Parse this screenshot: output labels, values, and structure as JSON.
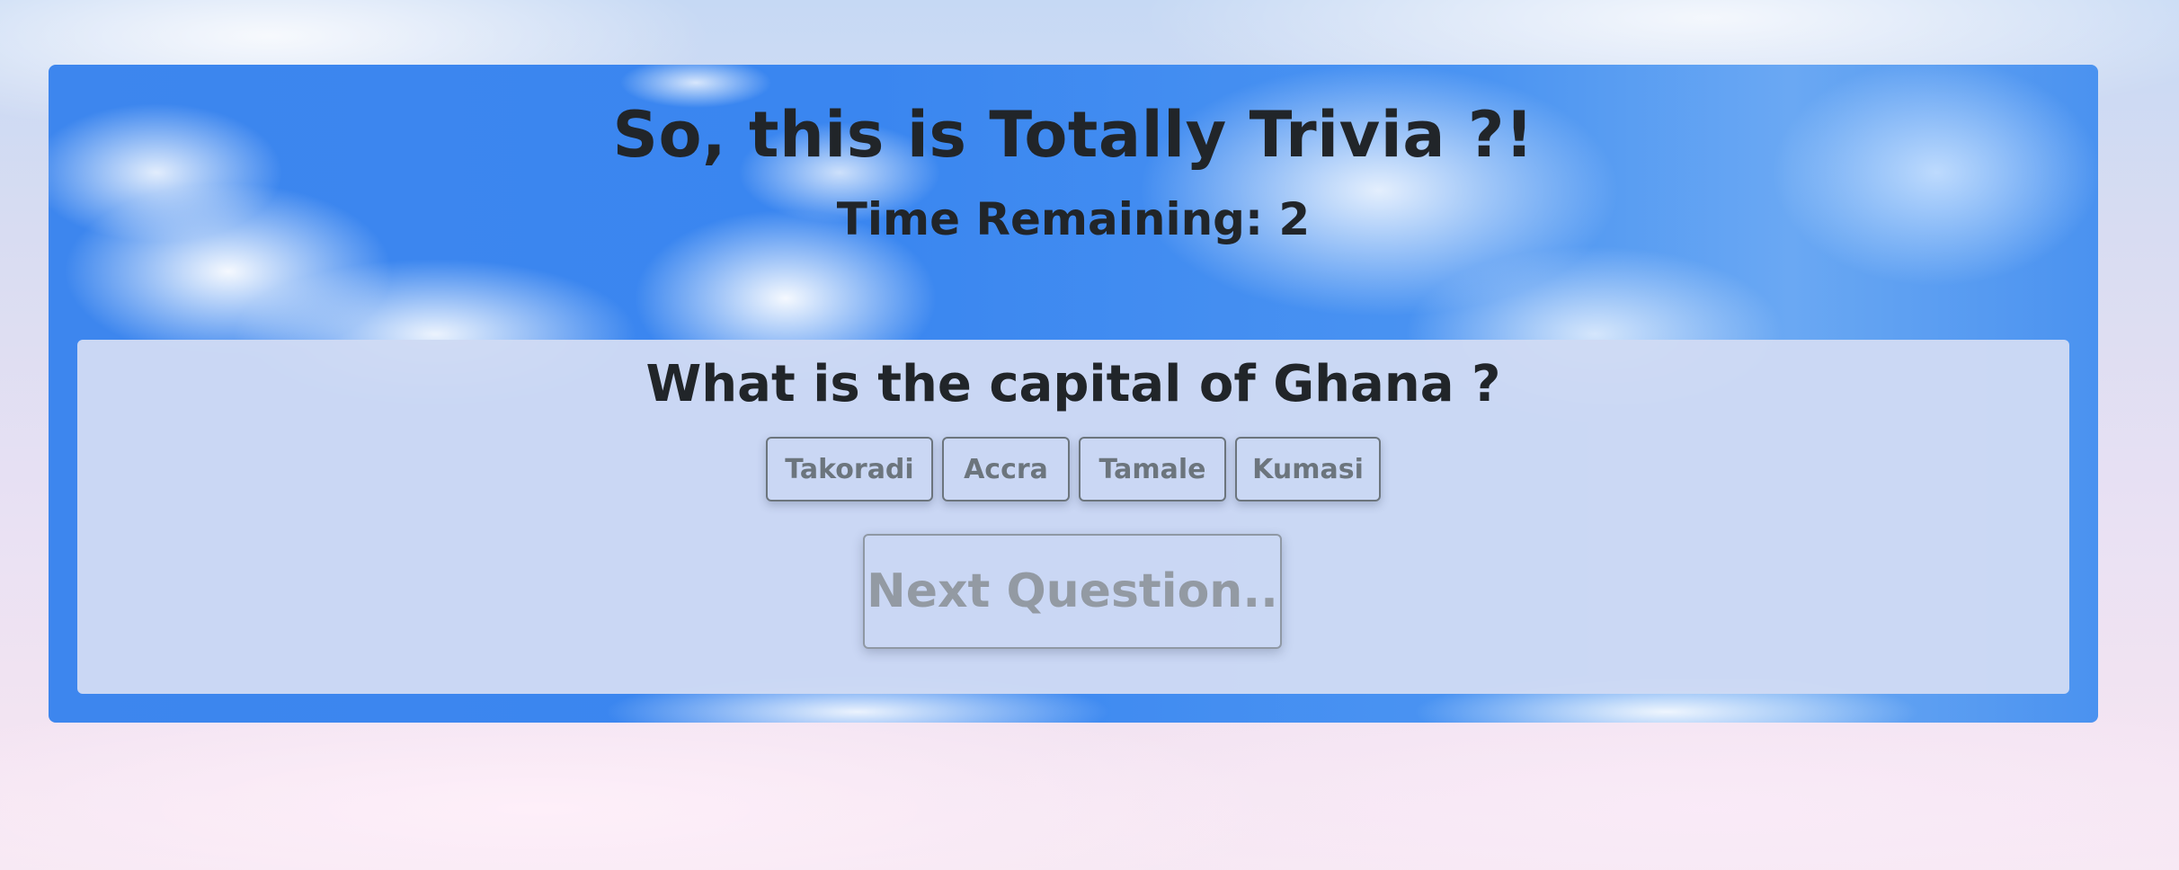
{
  "header": {
    "title": "So, this is Totally Trivia ?!",
    "timer_label": "Time Remaining:",
    "timer_value": "2"
  },
  "question": {
    "text": "What is the capital of Ghana ?",
    "answers": [
      {
        "label": "Takoradi"
      },
      {
        "label": "Accra"
      },
      {
        "label": "Tamale"
      },
      {
        "label": "Kumasi"
      }
    ]
  },
  "next_button": {
    "label": "Next Question.."
  },
  "colors": {
    "text": "#212529",
    "button_text": "#6c757d",
    "card_bg": "#cedaf4",
    "sky_blue": "#3d86ee"
  }
}
